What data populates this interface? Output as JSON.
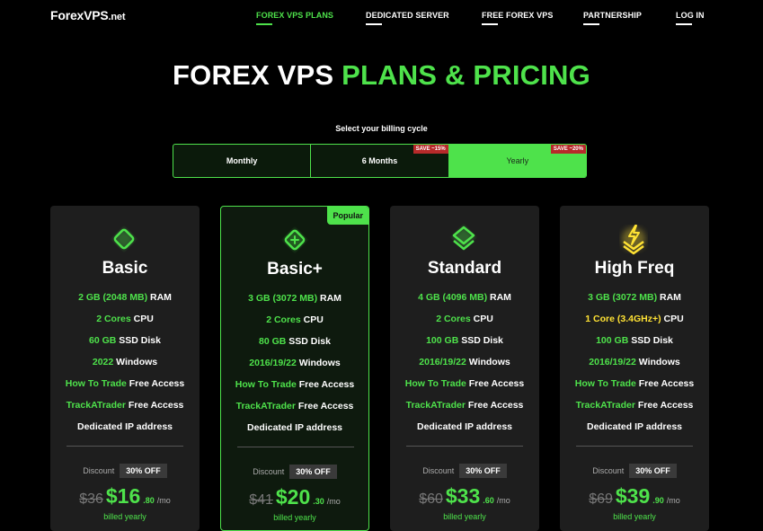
{
  "logo": {
    "brand": "Forex",
    "brand_bold": "VPS",
    "tld": ".net"
  },
  "nav": [
    {
      "label": "FOREX VPS PLANS",
      "active": true
    },
    {
      "label": "DEDICATED SERVER",
      "active": false
    },
    {
      "label": "FREE FOREX VPS",
      "active": false
    },
    {
      "label": "PARTNERSHIP",
      "active": false
    },
    {
      "label": "LOG IN",
      "active": false
    }
  ],
  "title": {
    "main": "FOREX VPS ",
    "accent": "PLANS & PRICING"
  },
  "billing": {
    "label": "Select your billing cycle",
    "options": [
      {
        "label": "Monthly",
        "badge": ""
      },
      {
        "label": "6 Months",
        "badge": "SAVE ~15%"
      },
      {
        "label": "Yearly",
        "badge": "SAVE ~20%"
      }
    ],
    "selected": "Yearly"
  },
  "colors": {
    "accent": "#4ee24b",
    "highlight": "#ffe234",
    "badge_red": "#b72a2a"
  },
  "plans": [
    {
      "name": "Basic",
      "icon": "diamond-icon",
      "popular": "",
      "ram_hl": "2 GB (2048 MB)",
      "ram": " RAM",
      "cpu_hl": "2 Cores",
      "cpu": " CPU",
      "disk_hl": "60 GB",
      "disk": " SSD Disk",
      "os_hl": "2022",
      "os": " Windows",
      "trade_hl": "How To Trade",
      "trade": " Free Access",
      "track_hl": "TrackATrader",
      "track": " Free Access",
      "ip": "Dedicated IP address",
      "discount_label": "Discount",
      "discount": "30% OFF",
      "old_price": "$36",
      "price": "$16",
      "cents": ".80",
      "per": "/mo",
      "billed": "billed yearly"
    },
    {
      "name": "Basic+",
      "icon": "diamond-plus-icon",
      "popular": "Popular",
      "ram_hl": "3 GB (3072 MB)",
      "ram": " RAM",
      "cpu_hl": "2 Cores",
      "cpu": " CPU",
      "disk_hl": "80 GB",
      "disk": " SSD Disk",
      "os_hl": "2016/19/22",
      "os": " Windows",
      "trade_hl": "How To Trade",
      "trade": " Free Access",
      "track_hl": "TrackATrader",
      "track": " Free Access",
      "ip": "Dedicated IP address",
      "discount_label": "Discount",
      "discount": "30% OFF",
      "old_price": "$41",
      "price": "$20",
      "cents": ".30",
      "per": "/mo",
      "billed": "billed yearly"
    },
    {
      "name": "Standard",
      "icon": "stack-icon",
      "popular": "",
      "ram_hl": "4 GB (4096 MB)",
      "ram": " RAM",
      "cpu_hl": "2 Cores",
      "cpu": " CPU",
      "disk_hl": "100 GB",
      "disk": " SSD Disk",
      "os_hl": "2016/19/22",
      "os": " Windows",
      "trade_hl": "How To Trade",
      "trade": " Free Access",
      "track_hl": "TrackATrader",
      "track": " Free Access",
      "ip": "Dedicated IP address",
      "discount_label": "Discount",
      "discount": "30% OFF",
      "old_price": "$60",
      "price": "$33",
      "cents": ".60",
      "per": "/mo",
      "billed": "billed yearly"
    },
    {
      "name": "High Freq",
      "icon": "lightning-stack-icon",
      "popular": "",
      "ram_hl": "3 GB (3072 MB)",
      "ram": " RAM",
      "cpu_hl": "1 Core (3.4GHz+)",
      "cpu": " CPU",
      "disk_hl": "100 GB",
      "disk": " SSD Disk",
      "os_hl": "2016/19/22",
      "os": " Windows",
      "trade_hl": "How To Trade",
      "trade": " Free Access",
      "track_hl": "TrackATrader",
      "track": " Free Access",
      "ip": "Dedicated IP address",
      "discount_label": "Discount",
      "discount": "30% OFF",
      "old_price": "$69",
      "price": "$39",
      "cents": ".90",
      "per": "/mo",
      "billed": "billed yearly"
    }
  ]
}
